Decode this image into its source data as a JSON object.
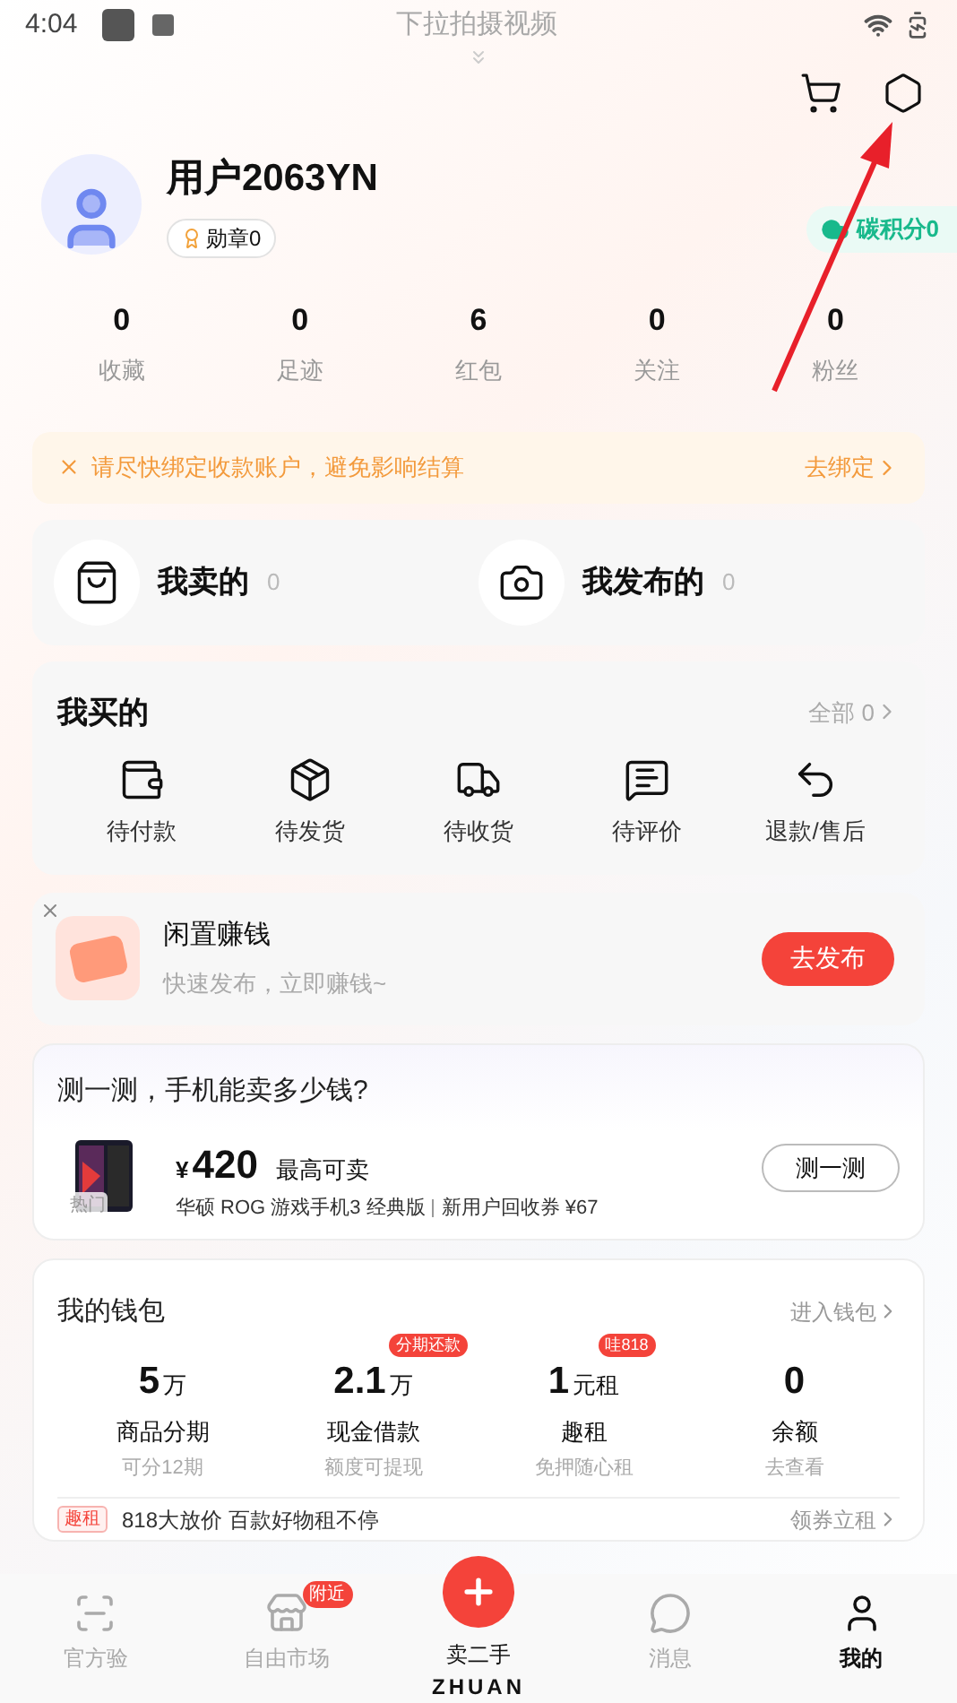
{
  "status_bar": {
    "time": "4:04"
  },
  "pull_hint": "下拉拍摄视频",
  "profile": {
    "name": "用户2063YN",
    "badge": "勋章0",
    "carbon": "碳积分0"
  },
  "stats": [
    {
      "value": "0",
      "label": "收藏"
    },
    {
      "value": "0",
      "label": "足迹"
    },
    {
      "value": "6",
      "label": "红包"
    },
    {
      "value": "0",
      "label": "关注"
    },
    {
      "value": "0",
      "label": "粉丝"
    }
  ],
  "notice": {
    "text": "请尽快绑定收款账户，避免影响结算",
    "action": "去绑定"
  },
  "selling": [
    {
      "label": "我卖的",
      "count": "0"
    },
    {
      "label": "我发布的",
      "count": "0"
    }
  ],
  "bought": {
    "title": "我买的",
    "all": "全部 0",
    "items": [
      {
        "label": "待付款"
      },
      {
        "label": "待发货"
      },
      {
        "label": "待收货"
      },
      {
        "label": "待评价"
      },
      {
        "label": "退款/售后"
      }
    ]
  },
  "promo": {
    "title": "闲置赚钱",
    "subtitle": "快速发布，立即赚钱~",
    "button": "去发布"
  },
  "estimate": {
    "title": "测一测，手机能卖多少钱?",
    "hot_tag": "热门",
    "currency": "¥",
    "price": "420",
    "price_note": "最高可卖",
    "product": "华硕 ROG 游戏手机3 经典版",
    "coupon": "新用户回收券 ¥67",
    "button": "测一测"
  },
  "wallet": {
    "title": "我的钱包",
    "link": "进入钱包",
    "items": [
      {
        "value": "5",
        "unit": "万",
        "label": "商品分期",
        "sub": "可分12期"
      },
      {
        "value": "2.1",
        "unit": "万",
        "tag": "分期还款",
        "label": "现金借款",
        "sub": "额度可提现"
      },
      {
        "value": "1",
        "unit": "元租",
        "tag": "哇818",
        "label": "趣租",
        "sub": "免押随心租"
      },
      {
        "value": "0",
        "label": "余额",
        "sub": "去查看"
      }
    ],
    "promo_row": {
      "tag": "趣租",
      "text": "818大放价 百款好物租不停",
      "link": "领券立租"
    }
  },
  "nav": [
    {
      "label": "官方验",
      "selected": false
    },
    {
      "label": "自由市场",
      "badge": "附近",
      "selected": false
    },
    {
      "label": "卖二手",
      "brand": "ZHUAN",
      "kind": "center",
      "selected": false
    },
    {
      "label": "消息",
      "selected": false
    },
    {
      "label": "我的",
      "selected": true
    }
  ]
}
